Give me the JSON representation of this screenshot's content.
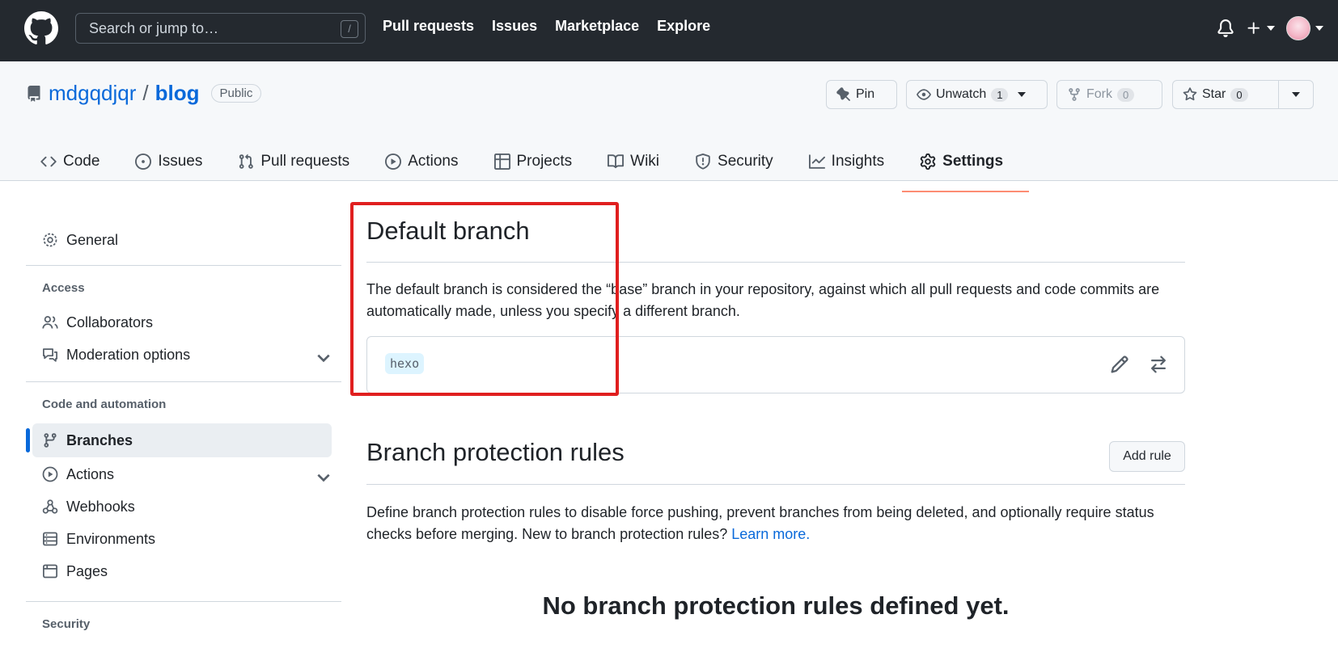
{
  "header": {
    "search_placeholder": "Search or jump to…",
    "search_shortcut": "/",
    "nav": [
      "Pull requests",
      "Issues",
      "Marketplace",
      "Explore"
    ],
    "plus_label": "+"
  },
  "repo": {
    "owner": "mdgqdjqr",
    "separator": "/",
    "name": "blog",
    "visibility": "Public",
    "pin_label": "Pin",
    "unwatch_label": "Unwatch",
    "watch_count": "1",
    "fork_label": "Fork",
    "fork_count": "0",
    "star_label": "Star",
    "star_count": "0"
  },
  "tabs": [
    {
      "label": "Code",
      "icon": "code-icon"
    },
    {
      "label": "Issues",
      "icon": "issue-icon"
    },
    {
      "label": "Pull requests",
      "icon": "pull-request-icon"
    },
    {
      "label": "Actions",
      "icon": "play-icon"
    },
    {
      "label": "Projects",
      "icon": "table-icon"
    },
    {
      "label": "Wiki",
      "icon": "book-icon"
    },
    {
      "label": "Security",
      "icon": "shield-icon"
    },
    {
      "label": "Insights",
      "icon": "graph-icon"
    },
    {
      "label": "Settings",
      "icon": "gear-icon",
      "active": true
    }
  ],
  "sidebar": {
    "general": "General",
    "access_heading": "Access",
    "collaborators": "Collaborators",
    "moderation": "Moderation options",
    "code_heading": "Code and automation",
    "branches": "Branches",
    "actions": "Actions",
    "webhooks": "Webhooks",
    "environments": "Environments",
    "pages": "Pages",
    "security_heading": "Security"
  },
  "main": {
    "default_branch_title": "Default branch",
    "default_branch_desc": "The default branch is considered the “base” branch in your repository, against which all pull requests and code commits are automatically made, unless you specify a different branch.",
    "branch_name": "hexo",
    "protection_title": "Branch protection rules",
    "add_rule_label": "Add rule",
    "protection_desc": "Define branch protection rules to disable force pushing, prevent branches from being deleted, and optionally require status checks before merging. New to branch protection rules?",
    "learn_more": "Learn more.",
    "empty_title": "No branch protection rules defined yet."
  },
  "colors": {
    "header_bg": "#24292f",
    "link": "#0969da",
    "active_tab_underline": "#fd8c73",
    "highlight_box": "#e01f1f"
  }
}
